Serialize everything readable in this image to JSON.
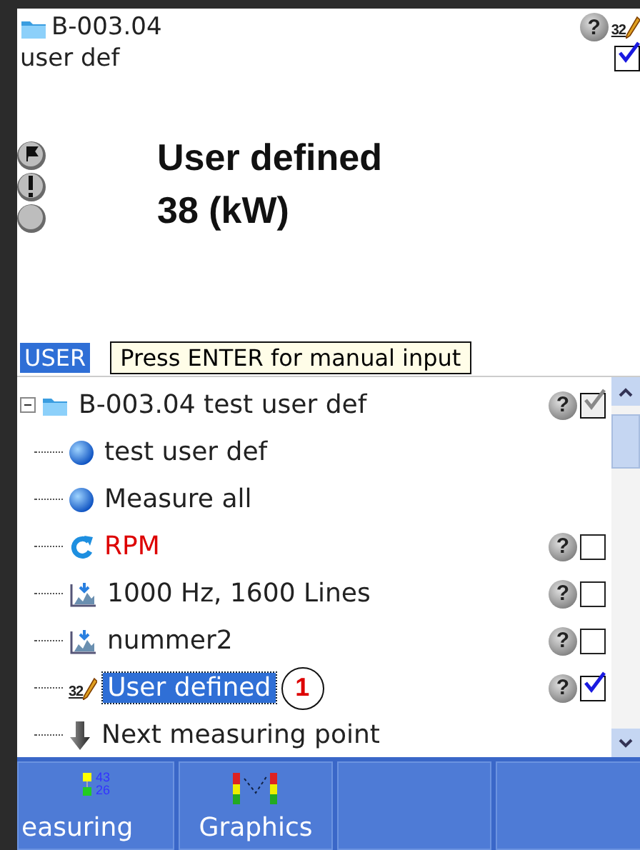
{
  "header": {
    "folder": "B-003.04",
    "subtitle": "user def",
    "help": "?",
    "value_type": "32",
    "checked": true
  },
  "measurement": {
    "title": "User defined",
    "value": "38 (kW)"
  },
  "side_buttons": [
    {
      "kind": "flag"
    },
    {
      "kind": "alert"
    },
    {
      "kind": "blank"
    }
  ],
  "mode_badge": "USER",
  "tooltip": "Press ENTER for manual input",
  "tree": {
    "label": "B-003.04 test user def",
    "kind": "folder",
    "expanded": true,
    "help": "?",
    "checked": true,
    "disabled": true,
    "selected": false,
    "children": [
      {
        "label": "test user def",
        "kind": "point",
        "selected": false
      },
      {
        "label": "Measure all",
        "kind": "point",
        "selected": false
      },
      {
        "label": "RPM",
        "kind": "speed",
        "help": "?",
        "checked": false,
        "selected": false
      },
      {
        "label": "1000 Hz, 1600 Lines",
        "kind": "spectrum",
        "help": "?",
        "checked": false,
        "selected": false
      },
      {
        "label": "nummer2",
        "kind": "spectrum",
        "help": "?",
        "checked": false,
        "selected": false
      },
      {
        "label": "User defined",
        "kind": "userdef",
        "icon_text": "32",
        "help": "?",
        "checked": true,
        "selected": true,
        "callout": "1"
      },
      {
        "label": "Next measuring point",
        "kind": "next",
        "selected": false
      }
    ]
  },
  "toolbar": [
    {
      "label": "easuring",
      "kind": "values",
      "icon_text": [
        "43",
        "26"
      ]
    },
    {
      "label": "Graphics",
      "kind": "graphics"
    },
    {
      "kind": "empty"
    },
    {
      "kind": "empty"
    }
  ]
}
